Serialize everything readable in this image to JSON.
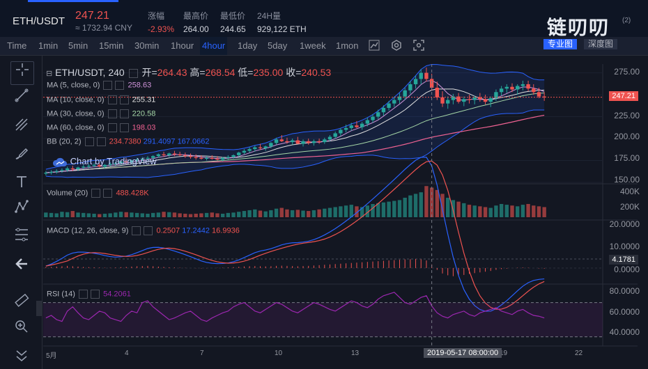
{
  "header": {
    "pair": "ETH/USDT",
    "last_price": "247.21",
    "cny_price": "≈ 1732.94 CNY",
    "stats": [
      {
        "key": "涨幅",
        "value": "-2.93%",
        "neg": true
      },
      {
        "key": "最高价",
        "value": "264.00",
        "neg": false
      },
      {
        "key": "最低价",
        "value": "244.65",
        "neg": false
      },
      {
        "key": "24H量",
        "value": "929,122 ETH",
        "neg": false
      }
    ],
    "brand": "链叨叨",
    "brand_tag": "(2)"
  },
  "toolbar": {
    "timeframes": [
      "Time",
      "1min",
      "5min",
      "15min",
      "30min",
      "1hour",
      "4hour",
      "1day",
      "5day",
      "1week",
      "1mon"
    ],
    "active_timeframe": "4hour",
    "icons": [
      "line-chart-icon",
      "gear-icon",
      "screenshot-icon"
    ],
    "views": [
      "专业图",
      "深度图"
    ]
  },
  "sidebar": {
    "tools": [
      "crosshair-icon",
      "trendline-icon",
      "pitchfork-icon",
      "brush-icon",
      "text-icon",
      "pattern-icon",
      "fib-icon",
      "back-arrow-icon",
      "ruler-icon",
      "zoom-in-icon",
      "collapse-icon"
    ]
  },
  "legend": {
    "main": {
      "title": "ETH/USDT, 240",
      "open_label": "开=",
      "open": "264.43",
      "high_label": "高=",
      "high": "268.54",
      "low_label": "低=",
      "low": "235.00",
      "close_label": "收=",
      "close": "240.53"
    },
    "ma": [
      {
        "label": "MA (5, close, 0)",
        "value": "258.63",
        "color": "#ce93d8"
      },
      {
        "label": "MA (10, close, 0)",
        "value": "255.31",
        "color": "#e0e0e0"
      },
      {
        "label": "MA (30, close, 0)",
        "value": "220.58",
        "color": "#a5d6a7"
      },
      {
        "label": "MA (60, close, 0)",
        "value": "198.03",
        "color": "#f06292"
      }
    ],
    "bb": {
      "label": "BB (20, 2)",
      "v1": "234.7380",
      "v2": "291.4097",
      "v3": "167.0662"
    },
    "volume": {
      "label": "Volume (20)",
      "value": "488.428K"
    },
    "macd": {
      "label": "MACD (12, 26, close, 9)",
      "v1": "0.2507",
      "v2": "17.2442",
      "v3": "16.9936"
    },
    "rsi": {
      "label": "RSI (14)",
      "value": "54.2061"
    }
  },
  "watermark": "Chart by TradingView",
  "price_axis": {
    "main": [
      "275.00",
      "250.00",
      "225.00",
      "200.00",
      "175.00",
      "150.00"
    ],
    "current": "247.21",
    "volume": [
      "400K",
      "200K"
    ],
    "macd": [
      "20.0000",
      "10.0000",
      "4.1781",
      "0.0000"
    ],
    "rsi": [
      "80.0000",
      "60.0000",
      "40.0000"
    ]
  },
  "time_axis": {
    "labels": [
      "5月",
      "4",
      "7",
      "10",
      "13",
      "19",
      "22"
    ],
    "cursor": "2019-05-17 08:00:00"
  },
  "chart_data": {
    "type": "candlestick",
    "title": "ETH/USDT, 240",
    "interval": "4hour",
    "ylim": [
      150,
      285
    ],
    "last": 247.21,
    "ohlc": [
      [
        160,
        163,
        158,
        161
      ],
      [
        161,
        164,
        159,
        162
      ],
      [
        162,
        165,
        160,
        163
      ],
      [
        163,
        166,
        161,
        164
      ],
      [
        164,
        168,
        162,
        166
      ],
      [
        166,
        169,
        163,
        165
      ],
      [
        165,
        168,
        163,
        167
      ],
      [
        167,
        170,
        165,
        168
      ],
      [
        168,
        171,
        166,
        169
      ],
      [
        169,
        172,
        167,
        170
      ],
      [
        170,
        172,
        167,
        168
      ],
      [
        168,
        171,
        166,
        170
      ],
      [
        170,
        173,
        168,
        171
      ],
      [
        171,
        174,
        169,
        172
      ],
      [
        172,
        175,
        170,
        174
      ],
      [
        174,
        177,
        171,
        173
      ],
      [
        173,
        176,
        171,
        175
      ],
      [
        175,
        178,
        173,
        176
      ],
      [
        176,
        179,
        174,
        177
      ],
      [
        177,
        180,
        175,
        178
      ],
      [
        178,
        181,
        176,
        180
      ],
      [
        180,
        183,
        178,
        182
      ],
      [
        182,
        185,
        179,
        181
      ],
      [
        181,
        184,
        179,
        183
      ],
      [
        183,
        186,
        180,
        182
      ],
      [
        182,
        185,
        180,
        181
      ],
      [
        181,
        184,
        178,
        180
      ],
      [
        180,
        183,
        177,
        179
      ],
      [
        179,
        182,
        176,
        178
      ],
      [
        178,
        181,
        176,
        177
      ],
      [
        177,
        180,
        175,
        178
      ],
      [
        178,
        181,
        176,
        177
      ],
      [
        177,
        180,
        175,
        176
      ],
      [
        176,
        179,
        174,
        178
      ],
      [
        178,
        181,
        176,
        179
      ],
      [
        179,
        182,
        177,
        181
      ],
      [
        181,
        185,
        179,
        184
      ],
      [
        184,
        188,
        182,
        186
      ],
      [
        186,
        190,
        184,
        188
      ],
      [
        188,
        192,
        185,
        190
      ],
      [
        190,
        194,
        187,
        189
      ],
      [
        189,
        192,
        186,
        191
      ],
      [
        191,
        196,
        189,
        195
      ],
      [
        195,
        201,
        193,
        199
      ],
      [
        199,
        204,
        196,
        197
      ],
      [
        197,
        201,
        194,
        196
      ],
      [
        196,
        200,
        193,
        198
      ],
      [
        198,
        202,
        195,
        194
      ],
      [
        194,
        199,
        191,
        197
      ],
      [
        197,
        200,
        193,
        195
      ],
      [
        195,
        199,
        192,
        197
      ],
      [
        197,
        200,
        194,
        196
      ],
      [
        196,
        201,
        194,
        199
      ],
      [
        199,
        204,
        197,
        202
      ],
      [
        202,
        208,
        200,
        206
      ],
      [
        206,
        212,
        203,
        210
      ],
      [
        210,
        216,
        207,
        212
      ],
      [
        212,
        218,
        209,
        215
      ],
      [
        215,
        220,
        212,
        213
      ],
      [
        213,
        219,
        210,
        217
      ],
      [
        217,
        224,
        214,
        221
      ],
      [
        221,
        228,
        218,
        225
      ],
      [
        225,
        233,
        222,
        230
      ],
      [
        230,
        238,
        226,
        235
      ],
      [
        235,
        243,
        232,
        240
      ],
      [
        240,
        248,
        236,
        244
      ],
      [
        244,
        252,
        240,
        248
      ],
      [
        248,
        258,
        244,
        255
      ],
      [
        255,
        266,
        251,
        262
      ],
      [
        262,
        272,
        257,
        268
      ],
      [
        268,
        279,
        262,
        275
      ],
      [
        275,
        281,
        265,
        268
      ],
      [
        268,
        274,
        255,
        258
      ],
      [
        258,
        265,
        244,
        247
      ],
      [
        247,
        254,
        236,
        240
      ],
      [
        240,
        248,
        234,
        244
      ],
      [
        244,
        251,
        239,
        248
      ],
      [
        248,
        252,
        240,
        242
      ],
      [
        242,
        248,
        237,
        245
      ],
      [
        245,
        250,
        240,
        244
      ],
      [
        244,
        249,
        239,
        247
      ],
      [
        247,
        252,
        242,
        245
      ],
      [
        245,
        250,
        239,
        242
      ],
      [
        242,
        248,
        236,
        246
      ],
      [
        246,
        256,
        243,
        253
      ],
      [
        253,
        260,
        249,
        257
      ],
      [
        257,
        262,
        252,
        259
      ],
      [
        259,
        263,
        253,
        256
      ],
      [
        256,
        262,
        250,
        260
      ],
      [
        260,
        266,
        255,
        262
      ],
      [
        262,
        266,
        254,
        257
      ],
      [
        257,
        262,
        250,
        253
      ],
      [
        253,
        258,
        246,
        248
      ],
      [
        248,
        253,
        243,
        247
      ]
    ],
    "volume": [
      60,
      55,
      50,
      70,
      65,
      80,
      60,
      55,
      50,
      45,
      40,
      45,
      50,
      60,
      70,
      65,
      60,
      55,
      50,
      45,
      55,
      60,
      70,
      65,
      60,
      50,
      45,
      40,
      45,
      50,
      55,
      60,
      50,
      45,
      55,
      60,
      70,
      80,
      90,
      100,
      85,
      75,
      90,
      110,
      120,
      100,
      90,
      95,
      85,
      80,
      90,
      100,
      110,
      120,
      130,
      140,
      150,
      160,
      140,
      130,
      150,
      170,
      180,
      190,
      200,
      210,
      220,
      250,
      280,
      300,
      320,
      400,
      380,
      350,
      300,
      250,
      220,
      200,
      180,
      160,
      150,
      140,
      130,
      120,
      150,
      170,
      160,
      150,
      140,
      160,
      170,
      150,
      140,
      130
    ],
    "rsi": [
      52,
      55,
      50,
      48,
      60,
      65,
      58,
      52,
      50,
      55,
      60,
      58,
      52,
      50,
      48,
      55,
      60,
      58,
      70,
      72,
      65,
      60,
      55,
      50,
      52,
      55,
      58,
      60,
      55,
      50,
      48,
      52,
      55,
      58,
      60,
      65,
      68,
      70,
      65,
      60,
      58,
      62,
      66,
      70,
      68,
      64,
      60,
      58,
      62,
      66,
      70,
      68,
      65,
      62,
      60,
      64,
      68,
      72,
      70,
      66,
      64,
      68,
      74,
      78,
      80,
      82,
      76,
      70,
      68,
      72,
      76,
      78,
      66,
      58,
      54,
      52,
      56,
      58,
      60,
      56,
      54,
      58,
      60,
      62,
      64,
      60,
      58,
      56,
      60,
      62,
      58,
      55,
      54,
      52
    ],
    "macd_hist": [
      0.5,
      0.6,
      0.8,
      1.0,
      1.2,
      1.0,
      0.8,
      0.6,
      0.5,
      0.4,
      0.3,
      0.2,
      0.2,
      0.3,
      0.5,
      0.6,
      0.8,
      1.0,
      1.1,
      1.2,
      1.0,
      0.8,
      0.6,
      0.4,
      0.3,
      0.2,
      0.1,
      0.0,
      -0.1,
      -0.2,
      -0.1,
      0.0,
      0.1,
      0.2,
      0.3,
      0.5,
      0.7,
      0.9,
      1.0,
      1.1,
      1.0,
      0.9,
      1.0,
      1.2,
      1.3,
      1.2,
      1.1,
      1.0,
      1.1,
      1.2,
      1.4,
      1.6,
      1.8,
      2.0,
      2.2,
      2.4,
      2.6,
      2.8,
      3.0,
      3.2,
      3.4,
      3.6,
      3.8,
      4.0,
      4.2,
      4.4,
      4.6,
      4.8,
      4.9,
      5.0,
      4.8,
      4.2,
      2.0,
      -1.0,
      -3.0,
      -4.0,
      -4.5,
      -4.2,
      -3.8,
      -3.2,
      -2.8,
      -2.4,
      -2.0,
      -1.6,
      -1.0,
      -0.6,
      -0.3,
      0.0,
      0.2,
      0.3,
      0.2,
      0.0,
      -0.2,
      -0.3
    ]
  }
}
